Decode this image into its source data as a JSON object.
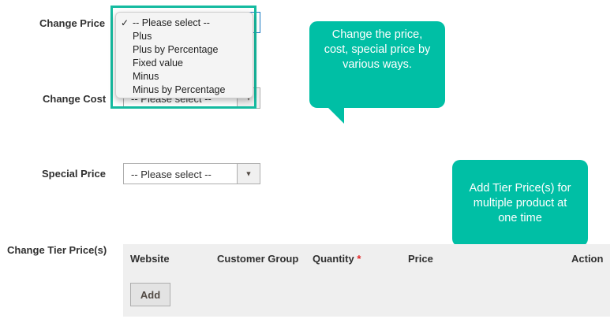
{
  "form": {
    "change_price": {
      "label": "Change Price",
      "options": [
        {
          "label": "-- Please select --",
          "selected": true
        },
        {
          "label": "Plus",
          "selected": false
        },
        {
          "label": "Plus by Percentage",
          "selected": false
        },
        {
          "label": "Fixed value",
          "selected": false
        },
        {
          "label": "Minus",
          "selected": false
        },
        {
          "label": "Minus by Percentage",
          "selected": false
        }
      ]
    },
    "change_cost": {
      "label": "Change Cost",
      "value": "-- Please select --"
    },
    "special_price": {
      "label": "Special Price",
      "value": "-- Please select --"
    },
    "tier_price": {
      "label": "Change Tier Price(s)",
      "columns": [
        "Website",
        "Customer Group",
        "Quantity",
        "Price",
        "Action"
      ],
      "required_marker": "*",
      "add_label": "Add"
    }
  },
  "callouts": {
    "price": "Change the price, cost, special price by various ways.",
    "tier": "Add Tier Price(s) for multiple product at one time"
  },
  "icons": {
    "dropdown_arrow": "triangle-down-icon",
    "check": "checkmark-icon"
  },
  "colors": {
    "accent": "#00bfa5",
    "highlight_border": "#15bba0",
    "required": "#e22626"
  }
}
